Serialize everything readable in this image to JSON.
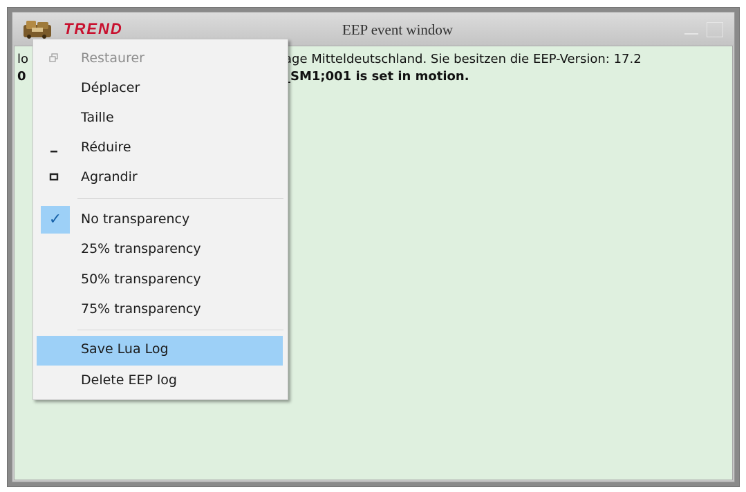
{
  "window": {
    "title": "EEP event window",
    "brand_logo": "TREND"
  },
  "log": {
    "line1_start": "lo",
    "line1_rest": "age Mitteldeutschland. Sie besitzen die EEP-Version: 17.2",
    "line2_start": "0",
    "line2_rest": "_SM1;001 is set in motion."
  },
  "menu": {
    "items": [
      {
        "label": "Restaurer",
        "icon": "restore-icon"
      },
      {
        "label": "Déplacer"
      },
      {
        "label": "Taille"
      },
      {
        "label": "Réduire",
        "icon": "minimize-icon"
      },
      {
        "label": "Agrandir",
        "icon": "maximize-icon"
      },
      {
        "label": "No transparency",
        "icon": "check-icon"
      },
      {
        "label": "25% transparency"
      },
      {
        "label": "50% transparency"
      },
      {
        "label": "75% transparency"
      },
      {
        "label": "Save Lua Log"
      },
      {
        "label": "Delete EEP log"
      }
    ]
  },
  "colors": {
    "client_bg": "#dff0df",
    "menu_bg": "#f2f2f2",
    "highlight": "#9dd0f7",
    "brand": "#c8102e"
  }
}
